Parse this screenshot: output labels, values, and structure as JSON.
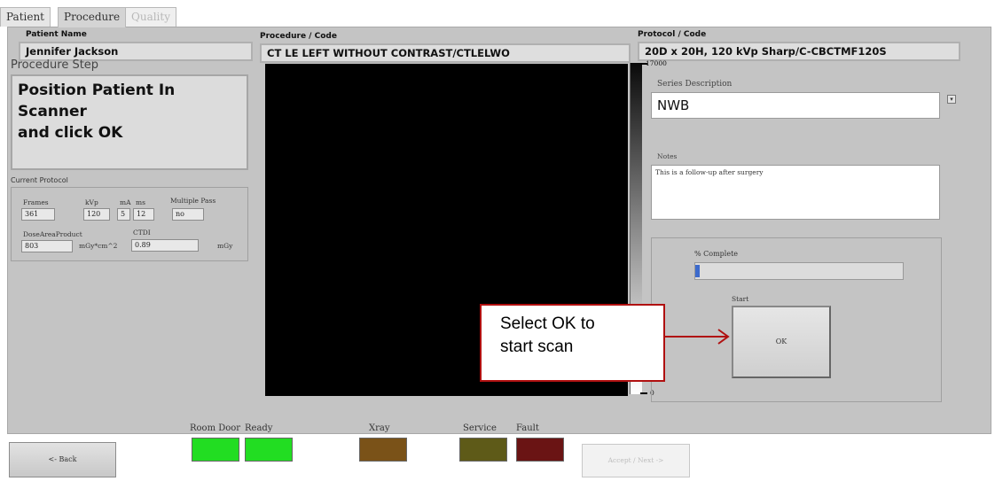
{
  "tabs": [
    {
      "label": "Patient"
    },
    {
      "label": "Procedure"
    },
    {
      "label": "Quality"
    }
  ],
  "header": {
    "patient_name_label": "Patient Name",
    "patient_name": "Jennifer Jackson",
    "procedure_label": "Procedure / Code",
    "procedure": "CT LE LEFT WITHOUT CONTRAST/CTLELWO",
    "protocol_label": "Protocol / Code",
    "protocol": "20D x 20H, 120 kVp Sharp/C-CBCTMF120S"
  },
  "procedure_step": {
    "title": "Procedure Step",
    "line1": "Position Patient In Scanner",
    "line2": "and click OK"
  },
  "current_protocol": {
    "title": "Current Protocol",
    "frames_label": "Frames",
    "frames": "361",
    "kvp_label": "kVp",
    "kvp": "120",
    "ma_label": "mA",
    "ma": "5",
    "ms_label": "ms",
    "ms": "12",
    "multipass_label": "Multiple Pass",
    "multipass": "no",
    "dap_label": "DoseAreaProduct",
    "dap": "803",
    "dap_unit": "mGy*cm^2",
    "ctdi_label": "CTDI",
    "ctdi": "0.89",
    "ctdi_unit": "mGy"
  },
  "grayscale": {
    "max": "17000",
    "min": "0"
  },
  "series": {
    "label": "Series Description",
    "value": "NWB",
    "notes_label": "Notes",
    "notes": "This is a follow-up after surgery"
  },
  "controls": {
    "percent_label": "% Complete",
    "percent": 1,
    "start_label": "Start",
    "ok_label": "OK"
  },
  "callout": {
    "line1": "Select OK to",
    "line2": "start scan"
  },
  "bottom": {
    "back_label": "<- Back",
    "room_door": "Room Door",
    "ready": "Ready",
    "xray": "Xray",
    "service": "Service",
    "fault": "Fault",
    "accept_label": "Accept / Next ->"
  },
  "colors": {
    "room_door": "#22dd22",
    "ready": "#22dd22",
    "xray": "#7a5218",
    "service": "#5e5a18",
    "fault": "#6a1414",
    "callout_border": "#b01010"
  }
}
